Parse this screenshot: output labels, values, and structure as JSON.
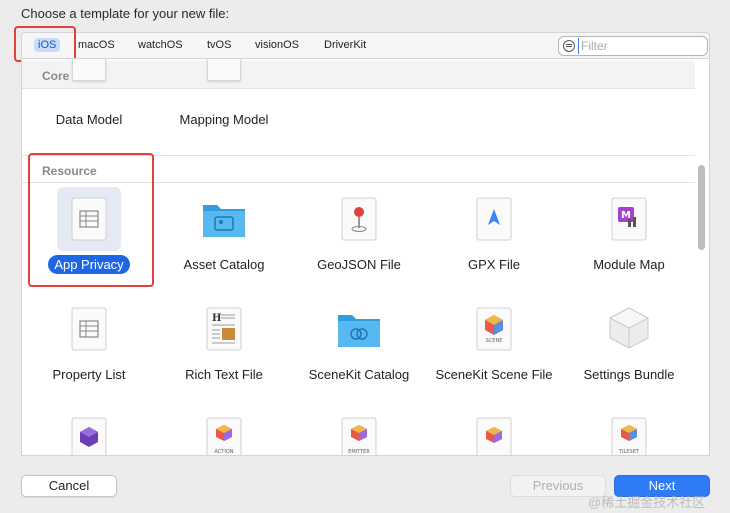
{
  "dialog": {
    "title": "Choose a template for your new file:"
  },
  "tabs": [
    {
      "label": "iOS",
      "selected": true
    },
    {
      "label": "macOS"
    },
    {
      "label": "watchOS"
    },
    {
      "label": "tvOS"
    },
    {
      "label": "visionOS"
    },
    {
      "label": "DriverKit"
    }
  ],
  "filter": {
    "placeholder": "Filter",
    "value": ""
  },
  "sections": {
    "core_data": {
      "title": "Core Data",
      "items": [
        {
          "label": "Data Model",
          "icon": "data-model-icon"
        },
        {
          "label": "Mapping Model",
          "icon": "mapping-model-icon"
        }
      ]
    },
    "resource": {
      "title": "Resource",
      "items": [
        {
          "label": "App Privacy",
          "icon": "app-privacy-icon",
          "selected": true
        },
        {
          "label": "Asset Catalog",
          "icon": "folder-icon"
        },
        {
          "label": "GeoJSON File",
          "icon": "map-pin-icon"
        },
        {
          "label": "GPX File",
          "icon": "location-arrow-icon"
        },
        {
          "label": "Module Map",
          "icon": "module-map-icon"
        },
        {
          "label": "Property List",
          "icon": "property-list-icon"
        },
        {
          "label": "Rich Text File",
          "icon": "rich-text-icon"
        },
        {
          "label": "SceneKit Catalog",
          "icon": "folder-icon"
        },
        {
          "label": "SceneKit Scene File",
          "icon": "scenekit-scene-icon"
        },
        {
          "label": "Settings Bundle",
          "icon": "settings-bundle-icon"
        },
        {
          "label": "",
          "icon": "reality-icon"
        },
        {
          "label": "",
          "icon": "action-icon"
        },
        {
          "label": "",
          "icon": "emitter-icon"
        },
        {
          "label": "",
          "icon": "scene-icon"
        },
        {
          "label": "",
          "icon": "tileset-icon"
        }
      ],
      "icon_badges": {
        "scene": "SCENE",
        "action": "ACTION",
        "emitter": "EMITTER",
        "tileset": "TILESET"
      }
    }
  },
  "buttons": {
    "cancel": "Cancel",
    "previous": "Previous",
    "next": "Next"
  },
  "watermark": "@稀土掘金技术社区",
  "colors": {
    "accent": "#2f7bf6",
    "highlight": "#e0413a",
    "selection": "#1f66e5"
  }
}
